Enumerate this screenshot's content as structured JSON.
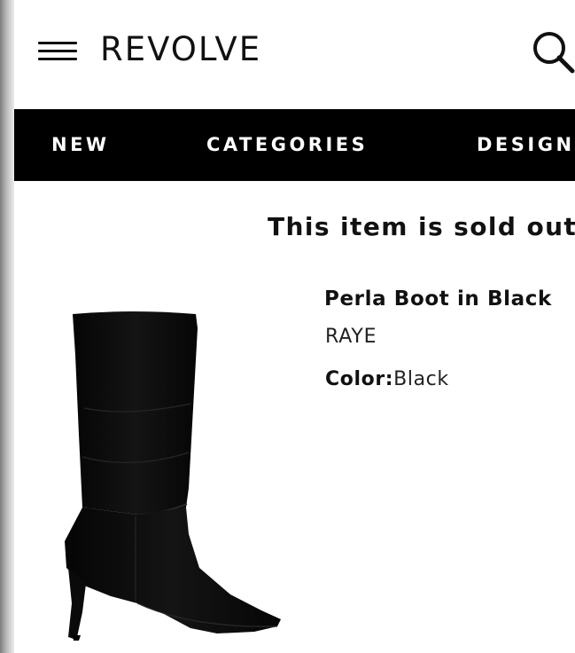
{
  "header": {
    "logo": "REVOLVE"
  },
  "nav": {
    "items": [
      {
        "label": "NEW"
      },
      {
        "label": "CATEGORIES"
      },
      {
        "label": "DESIGN"
      }
    ]
  },
  "product": {
    "status": "This item is sold out",
    "name": "Perla Boot in Black",
    "brand": "RAYE",
    "color_label": "Color:",
    "color_value": "Black",
    "image_alt": "black suede slouch boot"
  },
  "icons": {
    "menu": "hamburger-menu-icon",
    "search": "search-icon"
  },
  "colors": {
    "nav_background": "#000000",
    "text": "#111111",
    "background": "#ffffff"
  }
}
